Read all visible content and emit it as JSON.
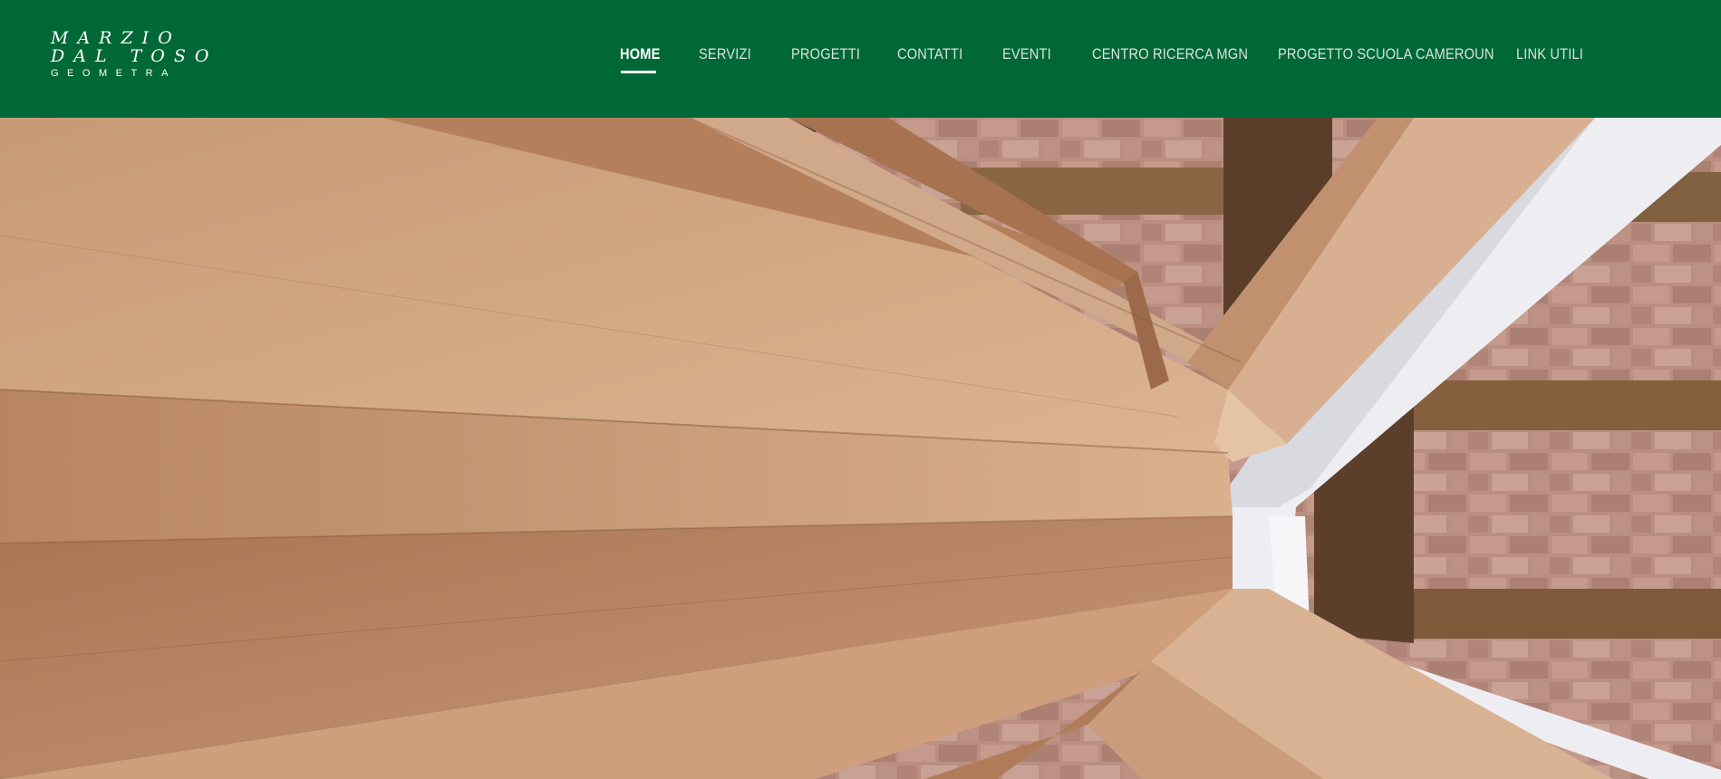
{
  "brand": {
    "logo_line1": "MARZIO",
    "logo_line2": "DAL TOSO",
    "logo_line3": "GEOMETRA"
  },
  "nav": {
    "items": [
      {
        "label": "HOME",
        "active": true
      },
      {
        "label": "SERVIZI",
        "active": false
      },
      {
        "label": "PROGETTI",
        "active": false
      },
      {
        "label": "CONTATTI",
        "active": false
      },
      {
        "label": "EVENTI",
        "active": false
      },
      {
        "label": "CENTRO RICERCA MGN",
        "active": false
      },
      {
        "label": "PROGETTO SCUOLA CAMEROUN",
        "active": false
      },
      {
        "label": "LINK UTILI",
        "active": false
      }
    ]
  },
  "colors": {
    "header_bg": "#006837",
    "nav_text": "#d8e3dc",
    "nav_active": "#ffffff"
  },
  "hero": {
    "image_subject": "wooden-ceiling-beams-photo"
  }
}
